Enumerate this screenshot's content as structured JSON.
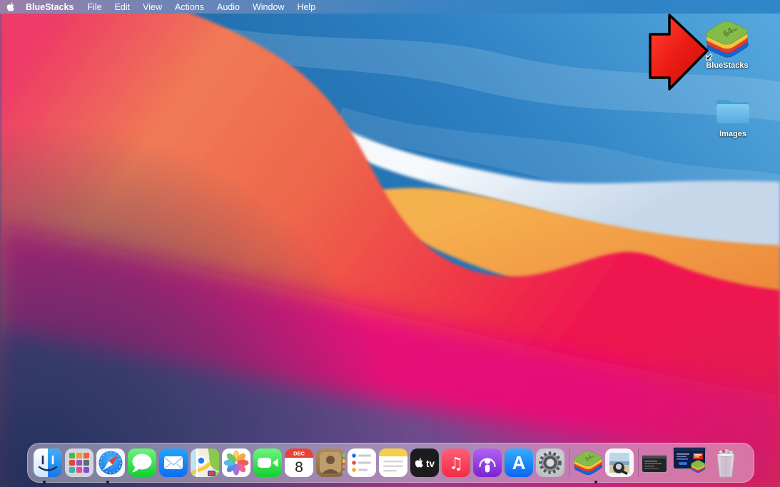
{
  "menu_bar": {
    "apple_icon": "apple-logo",
    "items": [
      {
        "label": "BlueStacks",
        "bold": true
      },
      {
        "label": "File"
      },
      {
        "label": "Edit"
      },
      {
        "label": "View"
      },
      {
        "label": "Actions"
      },
      {
        "label": "Audio"
      },
      {
        "label": "Window"
      },
      {
        "label": "Help"
      }
    ]
  },
  "desktop": {
    "icons": [
      {
        "label": "BlueStacks",
        "type": "app-alias",
        "badge": {
          "num": "64",
          "unit": "bit"
        }
      },
      {
        "label": "Images",
        "type": "folder"
      }
    ],
    "annotations": [
      {
        "type": "red-arrow",
        "points_to": "BlueStacks desktop icon"
      }
    ]
  },
  "dock": {
    "items": [
      "Finder",
      "Launchpad",
      "Safari",
      "Messages",
      "Mail",
      "Maps",
      "Photos",
      "FaceTime",
      "Calendar",
      "Contacts",
      "Reminders",
      "Notes",
      "TV",
      "Music",
      "Podcasts",
      "App Store",
      "System Preferences",
      "BlueStacks",
      "Preview",
      "Terminal window (minimized)",
      "BlueStacks installer window (minimized)",
      "Trash"
    ],
    "calendar": {
      "month": "DEC",
      "day": "8"
    },
    "apple_tv_text": "tv",
    "app_store_letter": "A",
    "running": [
      "Finder",
      "Safari",
      "BlueStacks"
    ]
  },
  "icons": {
    "music_note": "♫"
  },
  "colors": {
    "arrow_red": "#e31414",
    "wallpaper_blue": "#2e81c3",
    "wallpaper_white_wave": "#e9eff7",
    "wallpaper_orange": "#f2a84a",
    "wallpaper_salmon": "#ee674c",
    "wallpaper_pink": "#e60e7b",
    "wallpaper_purple": "#6d4b8c",
    "wallpaper_navy": "#1e2f57",
    "dock_background": "rgba(223,213,233,0.48)",
    "bluestacks_layers": [
      "#84bb4b",
      "#f4c53c",
      "#e23b34",
      "#1565d8"
    ]
  }
}
